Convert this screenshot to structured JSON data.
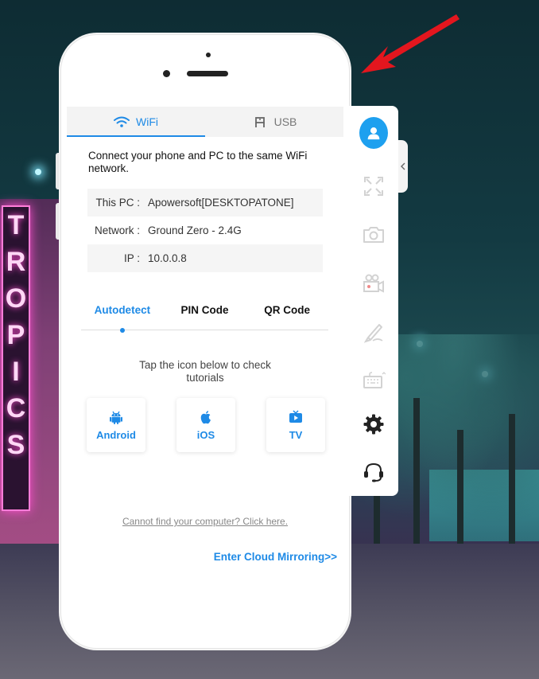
{
  "connection_tabs": [
    {
      "label": "WiFi",
      "icon": "wifi-icon",
      "active": true
    },
    {
      "label": "USB",
      "icon": "usb-icon",
      "active": false
    }
  ],
  "intro_text": "Connect your phone and PC to the same WiFi network.",
  "network_info": {
    "this_pc_label": "This PC :",
    "this_pc_value": "Apowersoft[DESKTOPATONE]",
    "network_label": "Network :",
    "network_value": "Ground Zero - 2.4G",
    "ip_label": "IP :",
    "ip_value": "10.0.0.8"
  },
  "modes": [
    {
      "label": "Autodetect",
      "active": true
    },
    {
      "label": "PIN Code",
      "active": false
    },
    {
      "label": "QR Code",
      "active": false
    }
  ],
  "hint_text": "Tap the icon below to check tutorials",
  "platforms": [
    {
      "label": "Android",
      "icon": "android-icon"
    },
    {
      "label": "iOS",
      "icon": "apple-icon"
    },
    {
      "label": "TV",
      "icon": "tv-icon"
    }
  ],
  "cannot_find_link": "Cannot find your computer? Click here.",
  "cloud_link": "Enter Cloud Mirroring>>",
  "toolbar": [
    "user-icon",
    "fullscreen-icon",
    "screenshot-icon",
    "record-icon",
    "whiteboard-icon",
    "keyboard-icon",
    "settings-icon",
    "support-icon"
  ],
  "colors": {
    "accent": "#1e8ae6",
    "avatar": "#1ea0ef",
    "arrow": "#e3161e"
  }
}
